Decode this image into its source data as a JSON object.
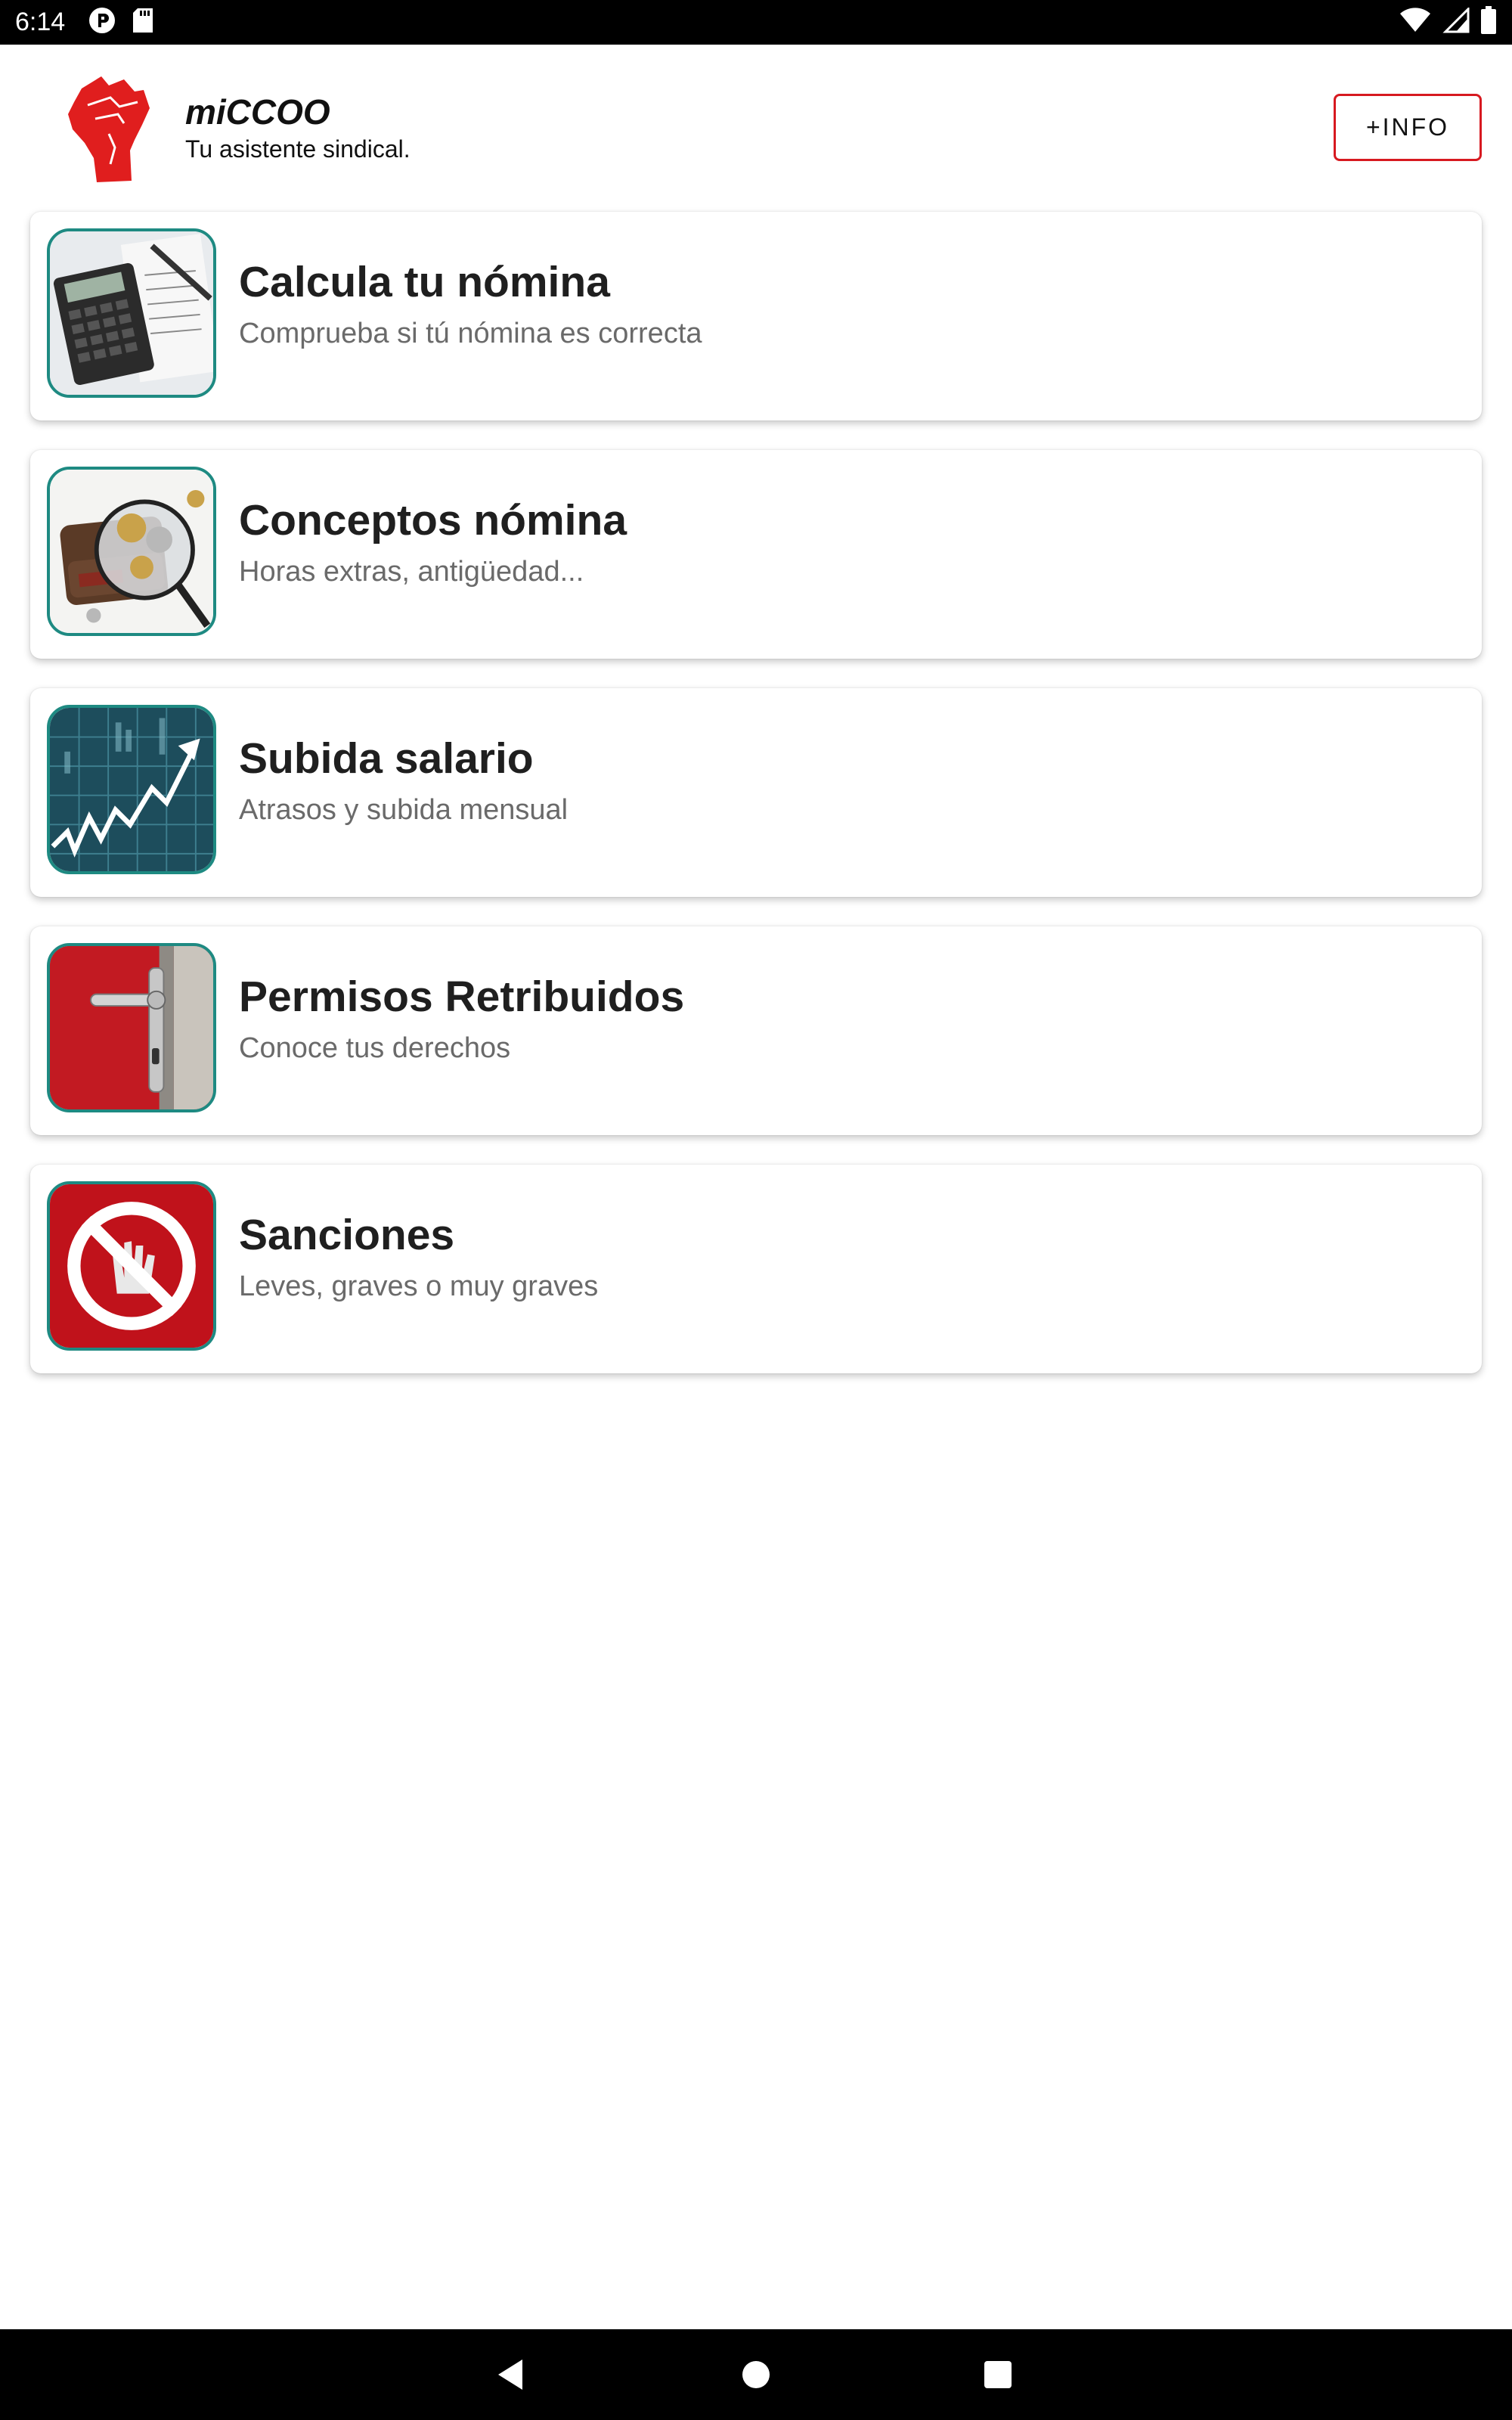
{
  "status_bar": {
    "time": "6:14",
    "left_icons": [
      "parking-notification-icon",
      "sd-card-icon"
    ],
    "right_icons": [
      "wifi-icon",
      "cell-signal-icon",
      "battery-icon"
    ]
  },
  "header": {
    "logo": "raised-fist-logo",
    "title": "miCCOO",
    "subtitle": "Tu asistente sindical.",
    "info_button_label": "+INFO"
  },
  "colors": {
    "accent_red": "#d71920",
    "thumb_border": "#1e8a82"
  },
  "menu": {
    "items": [
      {
        "title": "Calcula tu nómina",
        "subtitle": "Comprueba si tú nómina es correcta",
        "icon": "calculator-payslip-thumbnail"
      },
      {
        "title": "Conceptos nómina",
        "subtitle": "Horas extras, antigüedad...",
        "icon": "wallet-magnifier-thumbnail"
      },
      {
        "title": "Subida salario",
        "subtitle": "Atrasos y subida mensual",
        "icon": "rising-chart-thumbnail"
      },
      {
        "title": "Permisos Retribuidos",
        "subtitle": "Conoce tus derechos",
        "icon": "door-handle-thumbnail"
      },
      {
        "title": "Sanciones",
        "subtitle": "Leves, graves o muy graves",
        "icon": "prohibited-hand-thumbnail"
      }
    ]
  },
  "nav_bar": {
    "buttons": [
      "back-icon",
      "home-icon",
      "recents-icon"
    ]
  }
}
